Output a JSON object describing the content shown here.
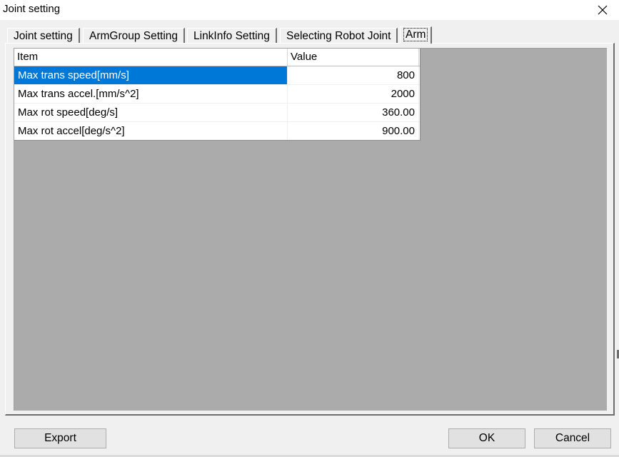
{
  "window": {
    "title": "Joint setting"
  },
  "tabs": [
    {
      "label": "Joint setting",
      "active": false
    },
    {
      "label": "ArmGroup Setting",
      "active": false
    },
    {
      "label": "LinkInfo Setting",
      "active": false
    },
    {
      "label": "Selecting Robot Joint",
      "active": false
    },
    {
      "label": "Arm",
      "active": true
    }
  ],
  "grid": {
    "columns": [
      "Item",
      "Value"
    ],
    "rows": [
      {
        "item": "Max trans speed[mm/s]",
        "value": "800",
        "selected": true
      },
      {
        "item": "Max trans accel.[mm/s^2]",
        "value": "2000",
        "selected": false
      },
      {
        "item": "Max rot speed[deg/s]",
        "value": "360.00",
        "selected": false
      },
      {
        "item": "Max rot accel[deg/s^2]",
        "value": "900.00",
        "selected": false
      }
    ]
  },
  "buttons": {
    "export": "Export",
    "ok": "OK",
    "cancel": "Cancel"
  },
  "colors": {
    "selection": "#0078d7",
    "grid_background": "#ababab"
  },
  "icons": {
    "close": "close-icon"
  }
}
